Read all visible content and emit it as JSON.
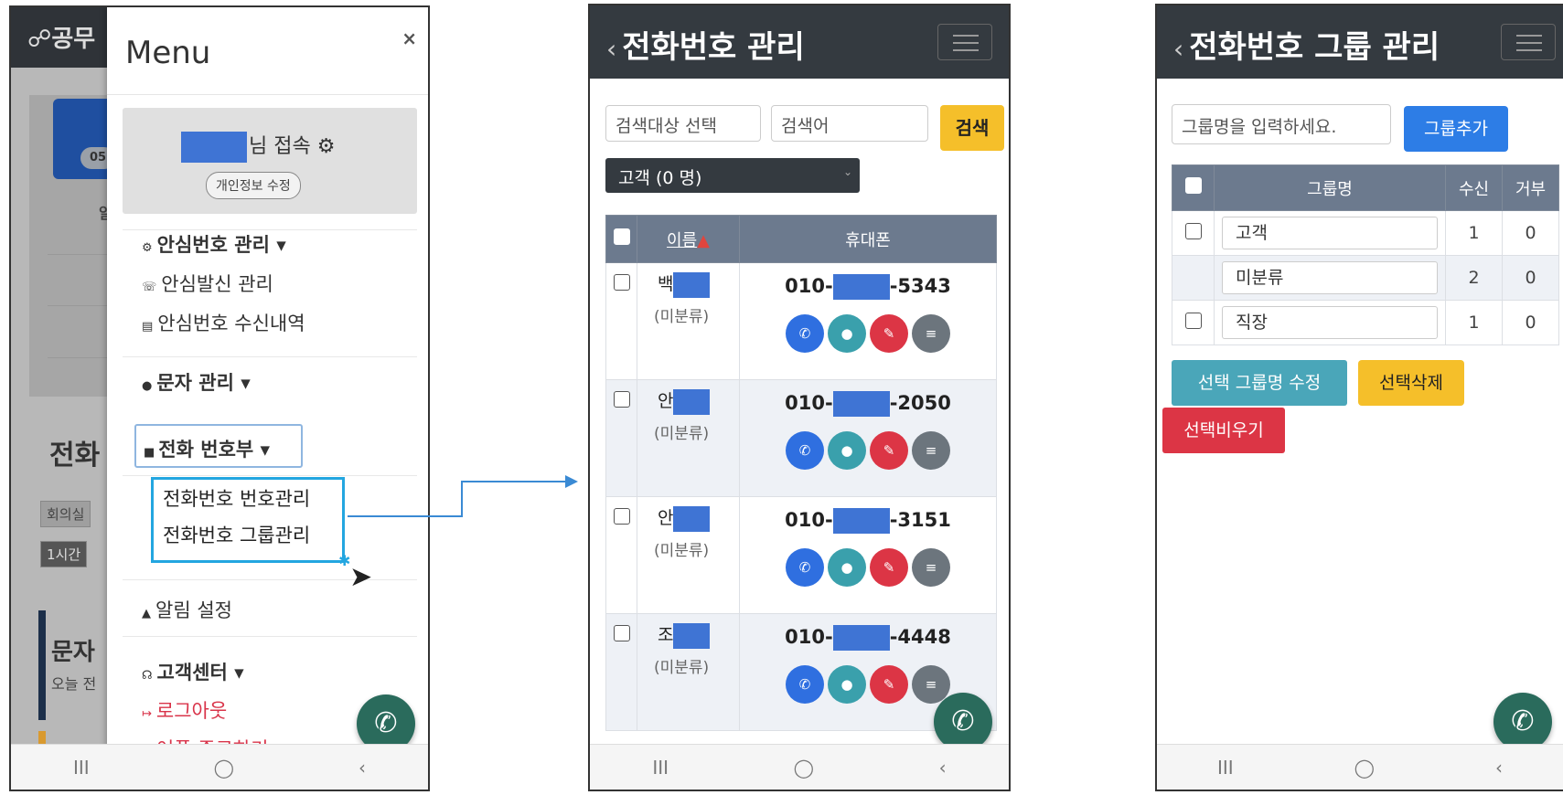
{
  "menu_screen": {
    "background": {
      "topbar_text": "☍공무",
      "badge": "05",
      "char_a": "알",
      "title": "전화",
      "chip1": "회의실",
      "chip2": "1시간",
      "title2": "문자",
      "sub": "오늘 전"
    },
    "title": "Menu",
    "close": "×",
    "user_suffix": "님 접속 ⚙",
    "edit_profile": "개인정보 수정",
    "items": {
      "safe_number": "안심번호 관리 ▾",
      "safe_call": "안심발신 관리",
      "safe_inbox": "안심번호 수신내역",
      "sms": "문자 관리 ▾",
      "phonebook": "전화 번호부 ▾",
      "sub_numbers": "전화번호 번호관리",
      "sub_groups": "전화번호 그룹관리",
      "alert": "알림 설정",
      "support": "고객센터 ▾",
      "logout": "로그아웃",
      "exit": "어플 종료하기"
    }
  },
  "numbers_screen": {
    "title": "전화번호 관리",
    "search_target": "검색대상 선택",
    "search_placeholder": "검색어",
    "search_button": "검색",
    "group_select": "고객 (0 명)",
    "col_name": "이름",
    "col_phone": "휴대폰",
    "rows": [
      {
        "name": "백",
        "group": "(미분류)",
        "prefix": "010-",
        "suffix": "-5343"
      },
      {
        "name": "안",
        "group": "(미분류)",
        "prefix": "010-",
        "suffix": "-2050"
      },
      {
        "name": "안",
        "group": "(미분류)",
        "prefix": "010-",
        "suffix": "-3151"
      },
      {
        "name": "조",
        "group": "(미분류)",
        "prefix": "010-",
        "suffix": "-4448"
      }
    ]
  },
  "groups_screen": {
    "title": "전화번호 그룹 관리",
    "group_placeholder": "그룹명을 입력하세요.",
    "add_button": "그룹추가",
    "col_group": "그룹명",
    "col_recv": "수신",
    "col_reject": "거부",
    "rows": [
      {
        "name": "고객",
        "recv": "1",
        "reject": "0"
      },
      {
        "name": "미분류",
        "recv": "2",
        "reject": "0"
      },
      {
        "name": "직장",
        "recv": "1",
        "reject": "0"
      }
    ],
    "edit_button": "선택 그룹명 수정",
    "delete_button": "선택삭제",
    "clear_button": "선택비우기"
  },
  "navbar": {
    "recent": "III",
    "home": "◯",
    "back": "‹"
  },
  "colors": {
    "accent_blue": "#2d7de6",
    "highlight": "#23a6e0",
    "danger": "#dc3545",
    "warning": "#f5bf2a"
  }
}
